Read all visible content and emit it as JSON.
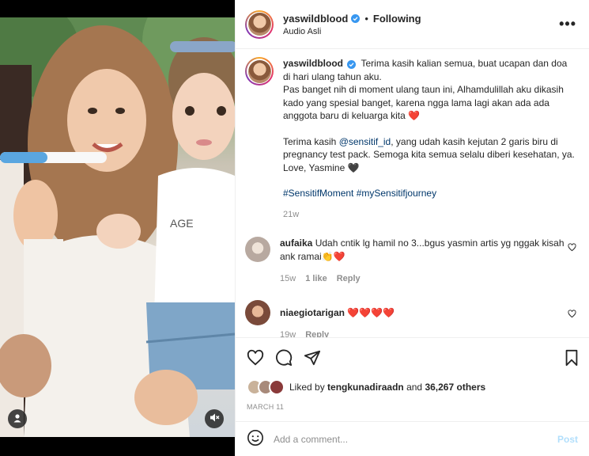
{
  "post": {
    "username": "yaswildblood",
    "follow_status": "Following",
    "separator": "•",
    "audio": "Audio Asli",
    "more": "•••"
  },
  "caption": {
    "username": "yaswildblood",
    "line1": "Terima kasih kalian semua, buat ucapan dan doa di hari ulang tahun aku.",
    "line2": "Pas banget nih di moment ulang taun ini, Alhamdulillah aku dikasih kado yang spesial banget, karena ngga lama lagi akan ada ada anggota baru di keluarga kita ❤️",
    "line3_pre": "Terima kasih ",
    "mention": "@sensitif_id",
    "line3_post": ", yang udah kasih kejutan 2 garis biru di pregnancy test pack. Semoga kita semua selalu diberi kesehatan, ya. Love, Yasmine 🖤",
    "hashtags": "#SensitifMoment #mySensitifjourney",
    "time": "21w"
  },
  "comments": [
    {
      "username": "aufaika",
      "text": "Udah cntik lg hamil no 3...bgus yasmin artis yg nggak kisah ank ramai👏❤️",
      "time": "15w",
      "likes": "1 like",
      "reply": "Reply",
      "avatar_color": "#b8a9a0"
    },
    {
      "username": "niaegiotarigan",
      "text": "❤️❤️❤️❤️",
      "time": "19w",
      "reply": "Reply",
      "avatar_color": "#7a4a3a"
    }
  ],
  "likes": {
    "prefix": "Liked by",
    "user": "tengkunadiraadn",
    "and": "and",
    "others": "36,267 others"
  },
  "date": "MARCH 11",
  "add_comment": {
    "placeholder": "Add a comment...",
    "post_label": "Post"
  },
  "colors": {
    "link": "#00376b",
    "verified": "#3897f0",
    "like_red": "#ed4956",
    "post_disabled": "#b2dffc",
    "muted": "#8e8e8e"
  }
}
